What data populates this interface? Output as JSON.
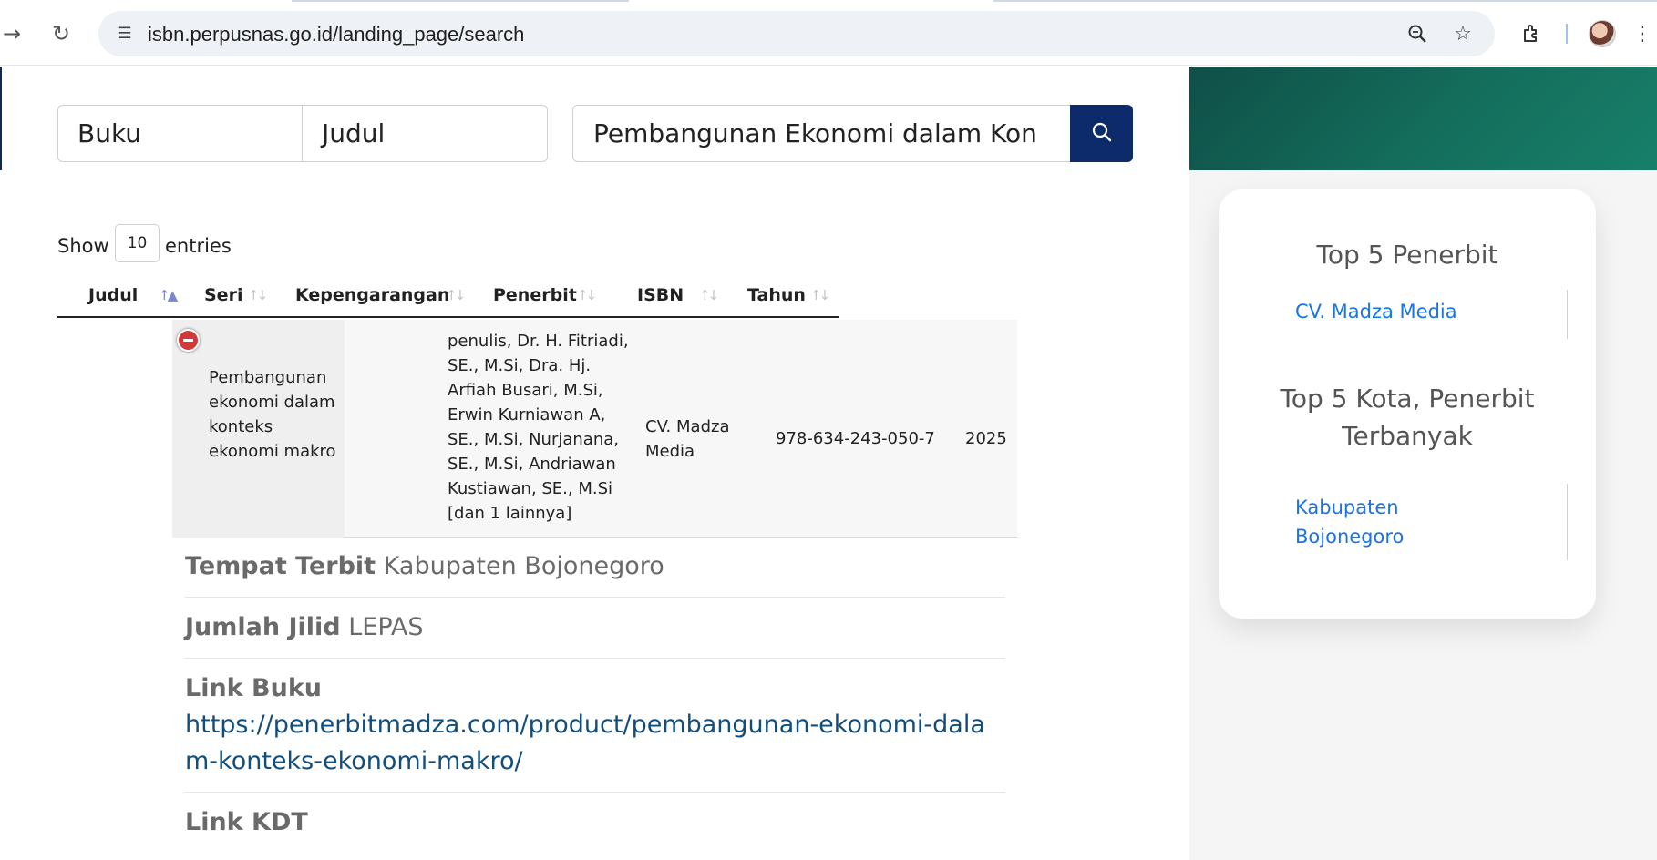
{
  "browser": {
    "url": "isbn.perpusnas.go.id/landing_page/search"
  },
  "search": {
    "type": "Buku",
    "field": "Judul",
    "query": "Pembangunan Ekonomi dalam Kon"
  },
  "table": {
    "show_label": "Show",
    "entries_value": "10",
    "entries_label": "entries",
    "columns": [
      "Judul",
      "Seri",
      "Kepengarangan",
      "Penerbit",
      "ISBN",
      "Tahun"
    ],
    "row": {
      "judul": "Pembangunan ekonomi dalam konteks ekonomi makro",
      "seri": "",
      "kepengarangan": "penulis, Dr. H. Fitriadi, SE., M.Si, Dra. Hj. Arfiah Busari, M.Si, Erwin Kurniawan A, SE., M.Si, Nurjanana, SE., M.Si, Andriawan Kustiawan, SE., M.Si [dan 1 lainnya]",
      "penerbit": "CV. Madza Media",
      "isbn": "978-634-243-050-7",
      "tahun": "2025"
    }
  },
  "detail": {
    "tempat_label": "Tempat Terbit",
    "tempat_value": "Kabupaten Bojonegoro",
    "jilid_label": "Jumlah Jilid",
    "jilid_value": "LEPAS",
    "link_buku_label": "Link Buku",
    "link_buku_value": "https://penerbitmadza.com/product/pembangunan-ekonomi-dalam-konteks-ekonomi-makro/",
    "link_kdt_label": "Link KDT"
  },
  "sidebar": {
    "top_penerbit_title": "Top 5 Penerbit",
    "top_penerbit_item": "CV. Madza Media",
    "top_kota_title": "Top 5 Kota, Penerbit Terbanyak",
    "top_kota_item": "Kabupaten Bojonegoro"
  },
  "colors": {
    "primary": "#0d2b6b",
    "link": "#1a73e8",
    "hero": "#146e5c",
    "collapse": "#d03a3a"
  }
}
